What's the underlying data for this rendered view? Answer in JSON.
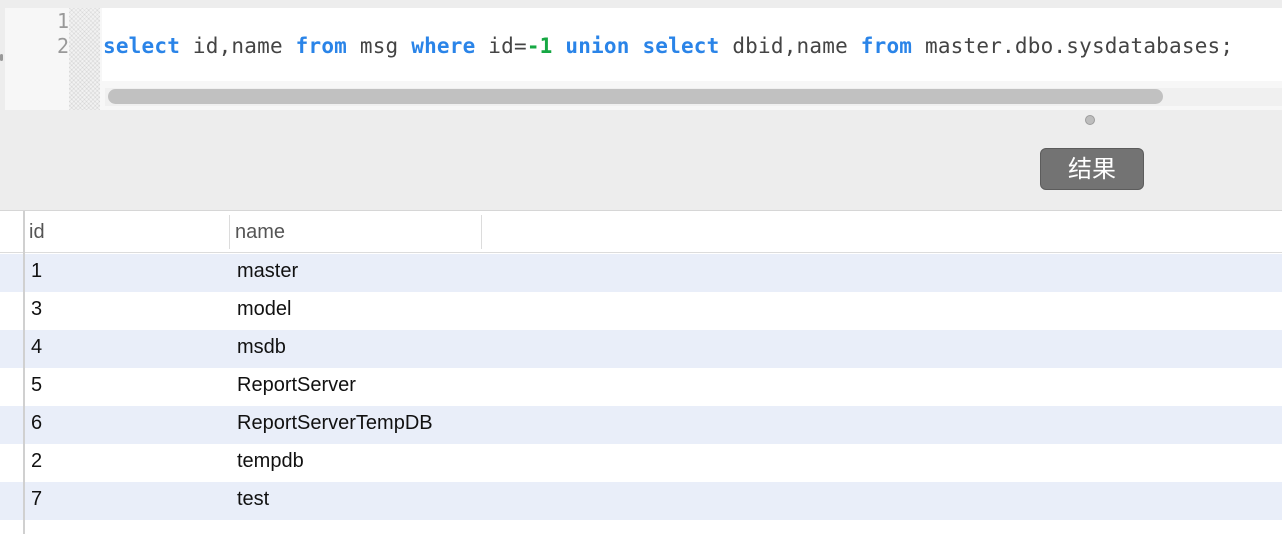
{
  "editor": {
    "line_numbers": [
      "1",
      "2"
    ],
    "code_tokens": [
      {
        "text": "select",
        "type": "kw"
      },
      {
        "text": " id,name ",
        "type": "plain"
      },
      {
        "text": "from",
        "type": "kw"
      },
      {
        "text": " msg ",
        "type": "plain"
      },
      {
        "text": "where",
        "type": "kw"
      },
      {
        "text": " id=",
        "type": "plain"
      },
      {
        "text": "-1",
        "type": "num"
      },
      {
        "text": " ",
        "type": "plain"
      },
      {
        "text": "union",
        "type": "kw"
      },
      {
        "text": " ",
        "type": "plain"
      },
      {
        "text": "select",
        "type": "kw"
      },
      {
        "text": " dbid,name ",
        "type": "plain"
      },
      {
        "text": "from",
        "type": "kw"
      },
      {
        "text": " master.dbo.sysdatabases;",
        "type": "plain"
      }
    ]
  },
  "toolbar": {
    "result_button_label": "结果"
  },
  "results": {
    "columns": [
      "id",
      "name"
    ],
    "rows": [
      {
        "id": "1",
        "name": "master"
      },
      {
        "id": "3",
        "name": "model"
      },
      {
        "id": "4",
        "name": "msdb"
      },
      {
        "id": "5",
        "name": "ReportServer"
      },
      {
        "id": "6",
        "name": "ReportServerTempDB"
      },
      {
        "id": "2",
        "name": "tempdb"
      },
      {
        "id": "7",
        "name": "test"
      }
    ]
  },
  "colors": {
    "keyword": "#2a84e8",
    "number": "#16a843",
    "row_alt": "#e9eef9",
    "button_bg": "#737373"
  }
}
